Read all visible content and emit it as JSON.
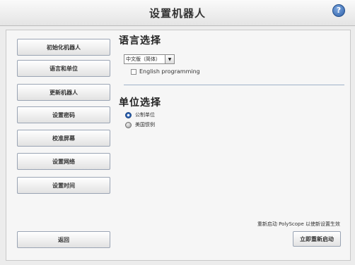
{
  "window": {
    "title": "设置机器人",
    "help_icon": "?"
  },
  "nav": {
    "items": [
      {
        "label": "初始化机器人"
      },
      {
        "label": "语言和单位"
      },
      {
        "label": "更新机器人"
      },
      {
        "label": "设置密码"
      },
      {
        "label": "校准屏幕"
      },
      {
        "label": "设置网络"
      },
      {
        "label": "设置时间"
      }
    ],
    "back_label": "返回"
  },
  "language": {
    "section_title": "语言选择",
    "selected": "中文版（简体）",
    "dropdown_arrow": "▼",
    "english_programming_label": "English programming",
    "english_programming_checked": false
  },
  "units": {
    "section_title": "单位选择",
    "options": [
      {
        "label": "公制单位",
        "selected": true
      },
      {
        "label": "美国惯例",
        "selected": false
      }
    ]
  },
  "restart": {
    "note": "重新启动 PolyScope 以使新设置生效",
    "button_label": "立即重新启动"
  },
  "colors": {
    "accent": "#2a5fb0",
    "divider": "#9fb1c8"
  }
}
